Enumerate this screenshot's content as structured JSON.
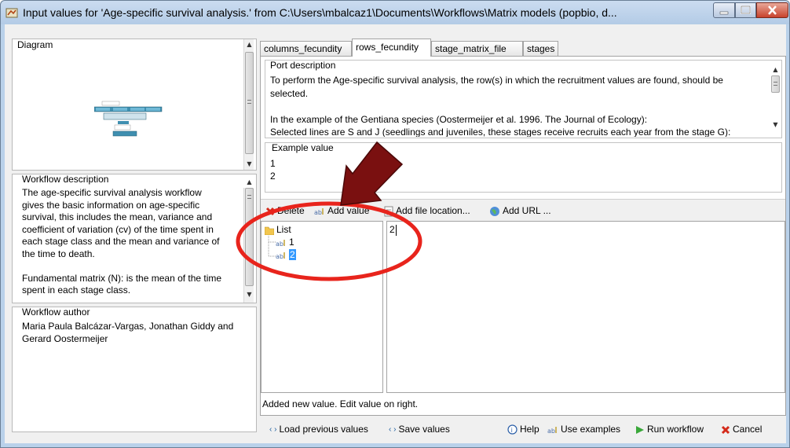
{
  "window": {
    "title": "Input values for 'Age-specific survival analysis.' from C:\\Users\\mbalcaz1\\Documents\\Workflows\\Matrix models (popbio, d..."
  },
  "left": {
    "diagram_label": "Diagram",
    "workflow_description_label": "Workflow description",
    "workflow_description_lines": [
      "The age-specific survival analysis workflow",
      "gives the basic information on age-specific",
      "survival, this includes the mean, variance and",
      "coefficient of variation (cv) of the time spent in",
      "each stage class and the mean and variance of",
      "the time to death.",
      "",
      "Fundamental matrix (N): is the mean of the time",
      "spent in each stage class."
    ],
    "workflow_author_label": "Workflow author",
    "workflow_author_lines": [
      "Maria Paula Balcázar-Vargas, Jonathan Giddy and",
      "Gerard Oostermeijer"
    ]
  },
  "tabs": [
    {
      "label": "columns_fecundity"
    },
    {
      "label": "rows_fecundity"
    },
    {
      "label": "stage_matrix_file"
    },
    {
      "label": "stages"
    }
  ],
  "port": {
    "label": "Port description",
    "lines": [
      "To perform the Age-specific survival analysis,  the row(s) in which the recruitment values are found, should be",
      "selected.",
      "",
      "In the example of the Gentiana species (Oostermeijer et al. 1996. The Journal of Ecology):",
      "Selected lines are S and J (seedlings and juveniles, these stages receive recruits each year from the stage G):"
    ]
  },
  "example": {
    "label": "Example value",
    "values": [
      "1",
      "2"
    ]
  },
  "toolbar": {
    "delete": "Delete",
    "add_value": "Add value",
    "add_file": "Add file location...",
    "add_url": "Add URL ..."
  },
  "tree": {
    "root": "List",
    "items": [
      "1",
      "2"
    ],
    "selected_index": 1
  },
  "editor": {
    "value": "2"
  },
  "status": "Added new value.  Edit value on right.",
  "bottom": {
    "load_previous": "Load previous values",
    "save_values": "Save values",
    "help": "Help",
    "use_examples": "Use examples",
    "run_workflow": "Run workflow",
    "cancel": "Cancel"
  },
  "colors": {
    "annotation_red": "#e8241c",
    "arrow_dark_red": "#7a1010",
    "selection_blue": "#3399ff"
  }
}
